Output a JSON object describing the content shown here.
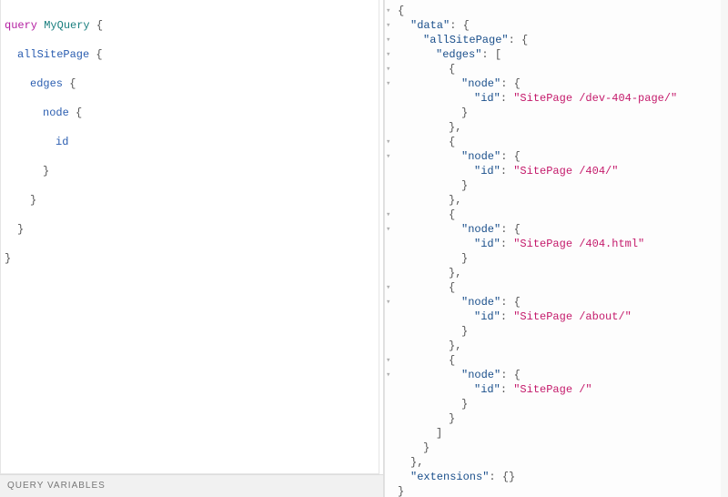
{
  "query": {
    "keyword": "query",
    "operation_name": "MyQuery",
    "fields": {
      "root": "allSitePage",
      "l2": "edges",
      "l3": "node",
      "l4": "id"
    }
  },
  "result": {
    "data_key": "data",
    "allSitePage_key": "allSitePage",
    "edges_key": "edges",
    "node_key": "node",
    "id_key": "id",
    "extensions_key": "extensions",
    "extensions_value": "{}",
    "edges": [
      {
        "id": "SitePage /dev-404-page/"
      },
      {
        "id": "SitePage /404/"
      },
      {
        "id": "SitePage /404.html"
      },
      {
        "id": "SitePage /about/"
      },
      {
        "id": "SitePage /"
      }
    ]
  },
  "footer": {
    "query_variables_label": "QUERY VARIABLES"
  }
}
